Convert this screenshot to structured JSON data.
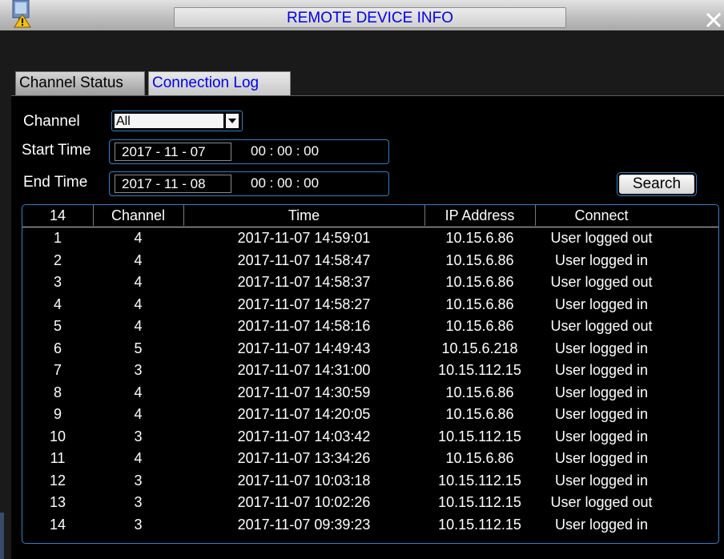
{
  "window": {
    "title": "REMOTE DEVICE INFO"
  },
  "icons": {
    "app": "monitor-warning-icon",
    "close": "close-icon",
    "dropdown": "chevron-down-icon"
  },
  "tabs": [
    {
      "label": "Channel Status",
      "active": false
    },
    {
      "label": "Connection Log",
      "active": true
    }
  ],
  "filters": {
    "channel_label": "Channel",
    "channel_value": "All",
    "start_label": "Start Time",
    "start_date": "2017 - 11 - 07",
    "start_time": "00 : 00 : 00",
    "end_label": "End Time",
    "end_date": "2017 - 11 - 08",
    "end_time": "00 : 00 : 00",
    "search_label": "Search"
  },
  "table": {
    "columns": [
      "14",
      "Channel",
      "Time",
      "IP Address",
      "Connect"
    ],
    "rows": [
      [
        "1",
        "4",
        "2017-11-07 14:59:01",
        "10.15.6.86",
        "User logged out"
      ],
      [
        "2",
        "4",
        "2017-11-07 14:58:47",
        "10.15.6.86",
        "User logged in"
      ],
      [
        "3",
        "4",
        "2017-11-07 14:58:37",
        "10.15.6.86",
        "User logged out"
      ],
      [
        "4",
        "4",
        "2017-11-07 14:58:27",
        "10.15.6.86",
        "User logged in"
      ],
      [
        "5",
        "4",
        "2017-11-07 14:58:16",
        "10.15.6.86",
        "User logged out"
      ],
      [
        "6",
        "5",
        "2017-11-07 14:49:43",
        "10.15.6.218",
        "User logged in"
      ],
      [
        "7",
        "3",
        "2017-11-07 14:31:00",
        "10.15.112.15",
        "User logged in"
      ],
      [
        "8",
        "4",
        "2017-11-07 14:30:59",
        "10.15.6.86",
        "User logged in"
      ],
      [
        "9",
        "4",
        "2017-11-07 14:20:05",
        "10.15.6.86",
        "User logged in"
      ],
      [
        "10",
        "3",
        "2017-11-07 14:03:42",
        "10.15.112.15",
        "User logged in"
      ],
      [
        "11",
        "4",
        "2017-11-07 13:34:26",
        "10.15.6.86",
        "User logged in"
      ],
      [
        "12",
        "3",
        "2017-11-07 10:03:18",
        "10.15.112.15",
        "User logged in"
      ],
      [
        "13",
        "3",
        "2017-11-07 10:02:26",
        "10.15.112.15",
        "User logged out"
      ],
      [
        "14",
        "3",
        "2017-11-07 09:39:23",
        "10.15.112.15",
        "User logged in"
      ]
    ]
  },
  "colors": {
    "accent_border": "#2f7fc5",
    "title_text": "#0000ee",
    "background": "#000000",
    "text": "#ffffff"
  }
}
